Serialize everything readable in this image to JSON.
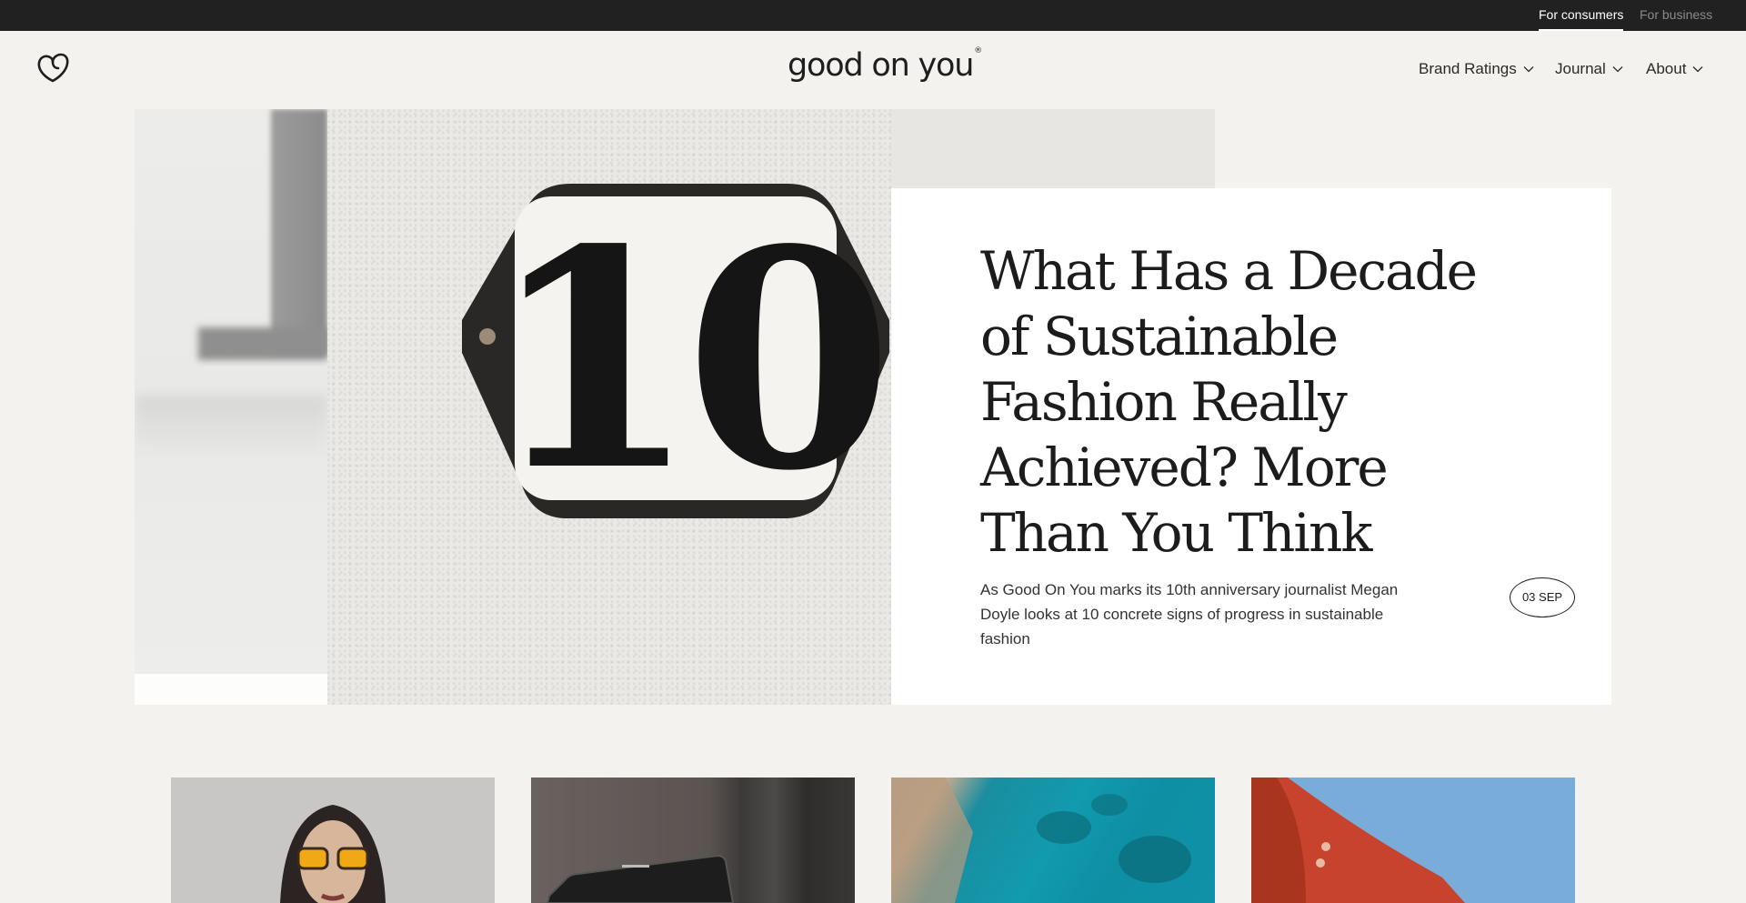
{
  "topbar": {
    "consumers_label": "For consumers",
    "business_label": "For business"
  },
  "header": {
    "brand_name": "good on you",
    "brand_mark": "®",
    "logo_icon": "heart-logo-icon",
    "nav": [
      {
        "label": "Brand Ratings"
      },
      {
        "label": "Journal"
      },
      {
        "label": "About"
      }
    ]
  },
  "hero": {
    "image_number": "10",
    "title": "What Has a Decade of Sustainable Fashion Really Achieved? More Than You Think",
    "excerpt": "As Good On You marks its 10th anniversary journalist Megan Doyle looks at 10 concrete signs of progress in sustainable fashion",
    "date": "03 SEP"
  },
  "colors": {
    "topbar_bg": "#212121",
    "page_bg": "#f3f2ef",
    "card_bg": "#ffffff",
    "text": "#1e1e1e"
  }
}
